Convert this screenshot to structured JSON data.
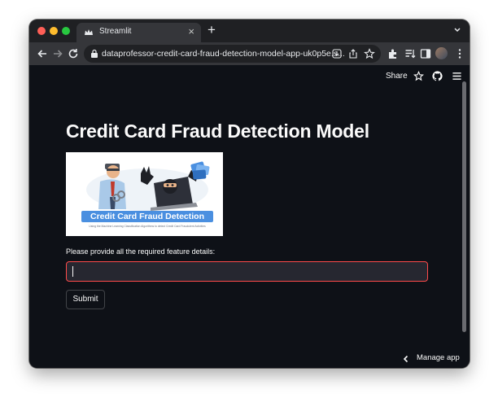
{
  "browser": {
    "tab_title": "Streamlit",
    "tab_close": "×",
    "new_tab": "+",
    "url": "dataprofessor-credit-card-fraud-detection-model-app-uk0p5e.s..."
  },
  "header": {
    "share_label": "Share"
  },
  "main": {
    "title": "Credit Card Fraud Detection Model",
    "banner_text": "Credit Card Fraud Detection",
    "banner_subtext": "Using the Machine Learning Classification Algorithms to detect Credit Card Fraudulent Activities",
    "input_label": "Please provide all the required feature details:",
    "input_value": "",
    "submit_label": "Submit"
  },
  "footer": {
    "manage_app_label": "Manage app"
  },
  "colors": {
    "app_background": "#0e1117",
    "input_background": "#262730",
    "input_focus_border": "#ff4b4b",
    "text": "#fafafa"
  },
  "icons": [
    "streamlit-crown-icon",
    "back-arrow-icon",
    "forward-arrow-icon",
    "reload-icon",
    "lock-icon",
    "download-icon",
    "share-page-icon",
    "star-icon",
    "extensions-icon",
    "reading-list-icon",
    "sidebar-icon",
    "profile-avatar-icon",
    "kebab-menu-icon",
    "github-icon",
    "hamburger-menu-icon",
    "chevron-left-icon"
  ]
}
